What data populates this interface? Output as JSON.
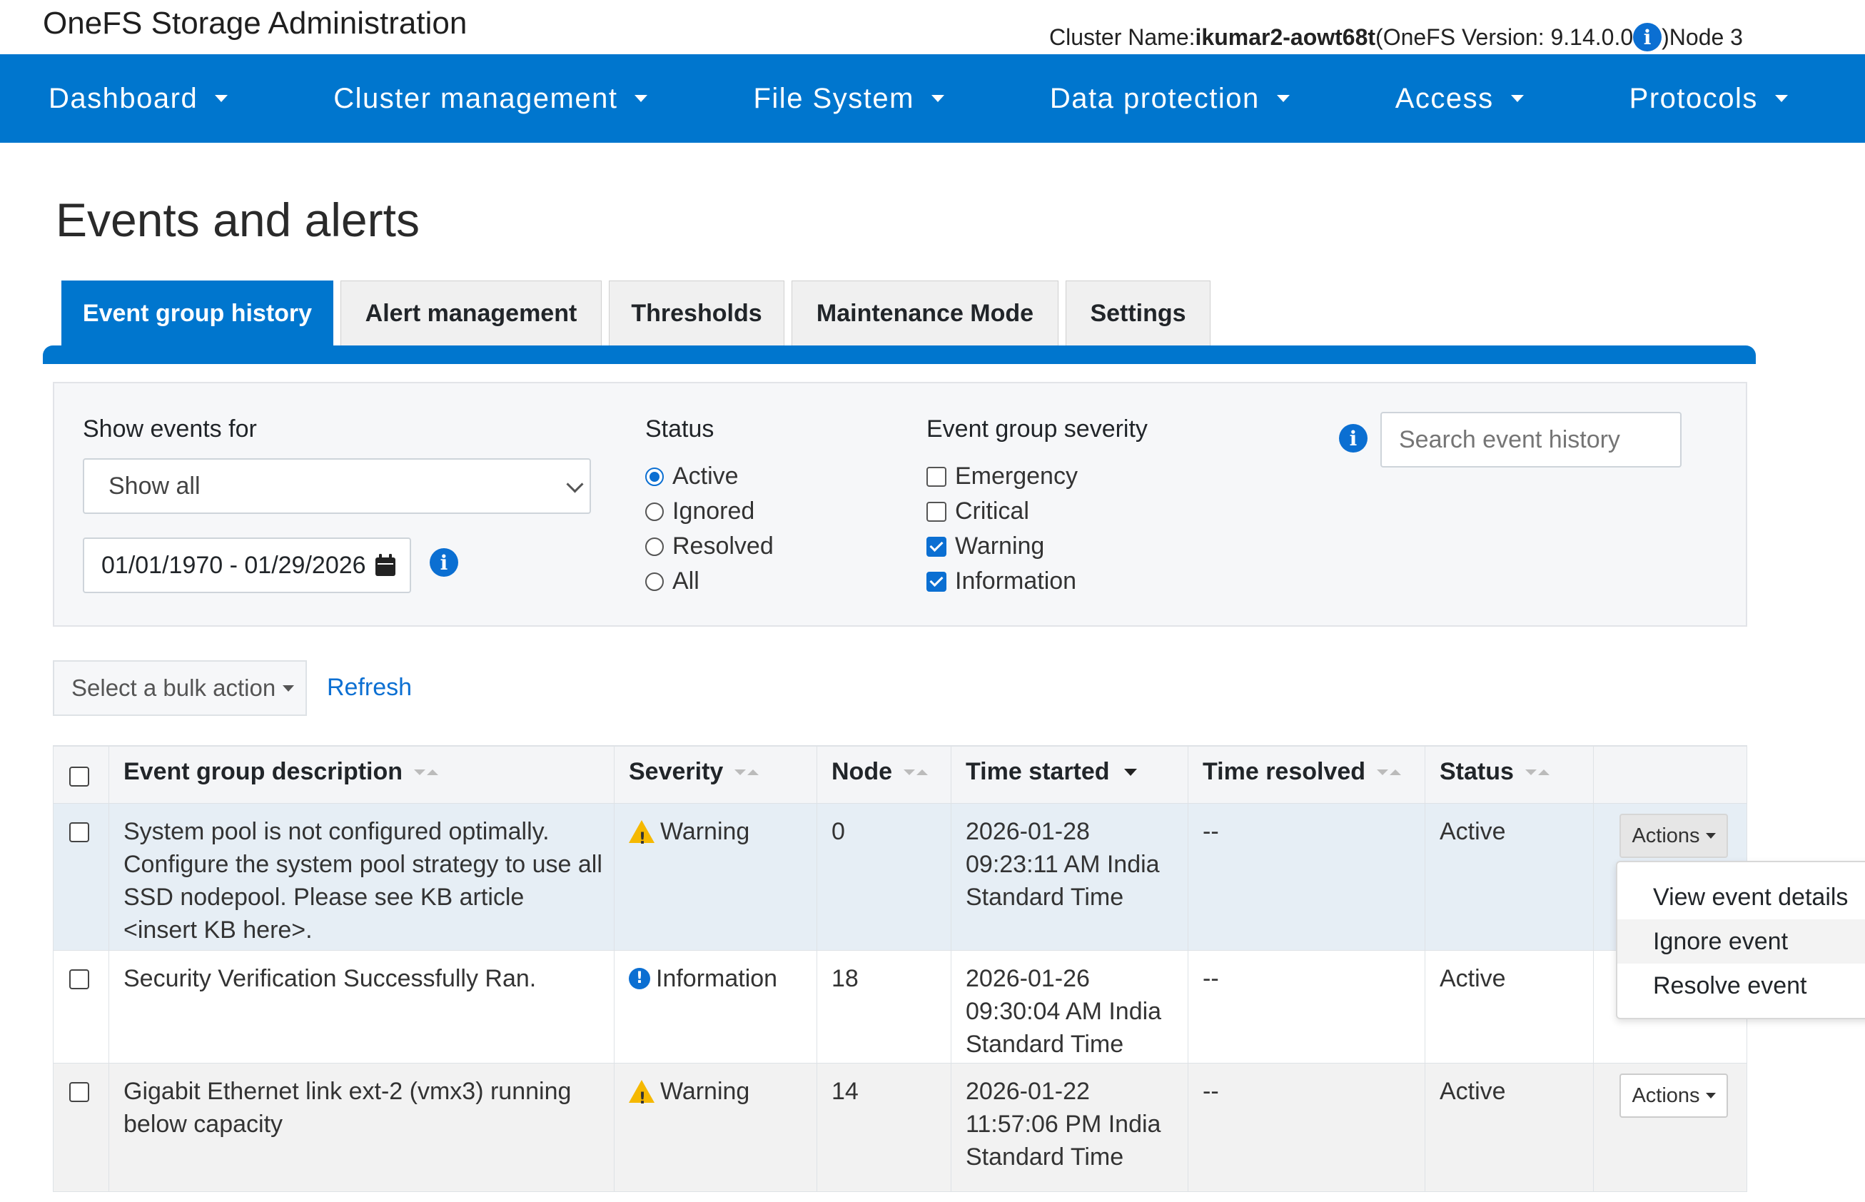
{
  "header": {
    "app_title": "OneFS Storage Administration",
    "cluster_label": "Cluster Name: ",
    "cluster_name": "ikumar2-aowt68t",
    "version_text": "(OneFS Version: 9.14.0.0",
    "node_text": ")Node 3"
  },
  "nav": {
    "items": [
      {
        "label": "Dashboard"
      },
      {
        "label": "Cluster management"
      },
      {
        "label": "File System"
      },
      {
        "label": "Data protection"
      },
      {
        "label": "Access"
      },
      {
        "label": "Protocols"
      }
    ],
    "color": "#0076ce"
  },
  "page": {
    "title": "Events and alerts"
  },
  "tabs": [
    {
      "label": "Event group history",
      "active": true
    },
    {
      "label": "Alert management"
    },
    {
      "label": "Thresholds"
    },
    {
      "label": "Maintenance Mode"
    },
    {
      "label": "Settings"
    }
  ],
  "filters": {
    "show_events_label": "Show events for",
    "show_events_value": "Show all",
    "date_range": "01/01/1970 - 01/29/2026",
    "status_label": "Status",
    "status_options": [
      {
        "label": "Active",
        "checked": true
      },
      {
        "label": "Ignored"
      },
      {
        "label": "Resolved"
      },
      {
        "label": "All"
      }
    ],
    "severity_label": "Event group severity",
    "severity_options": [
      {
        "label": "Emergency"
      },
      {
        "label": "Critical"
      },
      {
        "label": "Warning",
        "checked": true
      },
      {
        "label": "Information",
        "checked": true
      }
    ],
    "search_placeholder": "Search event history"
  },
  "toolbar": {
    "bulk_action": "Select a bulk action",
    "refresh": "Refresh"
  },
  "table": {
    "columns": [
      "Event group description",
      "Severity",
      "Node",
      "Time started",
      "Time resolved",
      "Status"
    ],
    "rows": [
      {
        "description": "System pool is not configured optimally. Configure the system pool strategy to use all SSD nodepool. Please see KB article <insert KB here>.",
        "severity": "Warning",
        "node": "0",
        "time_started": "2026-01-28 09:23:11 AM India Standard Time",
        "time_resolved": "--",
        "status": "Active",
        "actions": "Actions"
      },
      {
        "description": "Security Verification Successfully Ran.",
        "severity": "Information",
        "node": "18",
        "time_started": "2026-01-26 09:30:04 AM India Standard Time",
        "time_resolved": "--",
        "status": "Active"
      },
      {
        "description": "Gigabit Ethernet link ext-2 (vmx3) running below capacity",
        "severity": "Warning",
        "node": "14",
        "time_started": "2026-01-22 11:57:06 PM India Standard Time",
        "time_resolved": "--",
        "status": "Active",
        "actions": "Actions"
      }
    ]
  },
  "actions_menu": {
    "items": [
      "View event details",
      "Ignore event",
      "Resolve event"
    ]
  }
}
